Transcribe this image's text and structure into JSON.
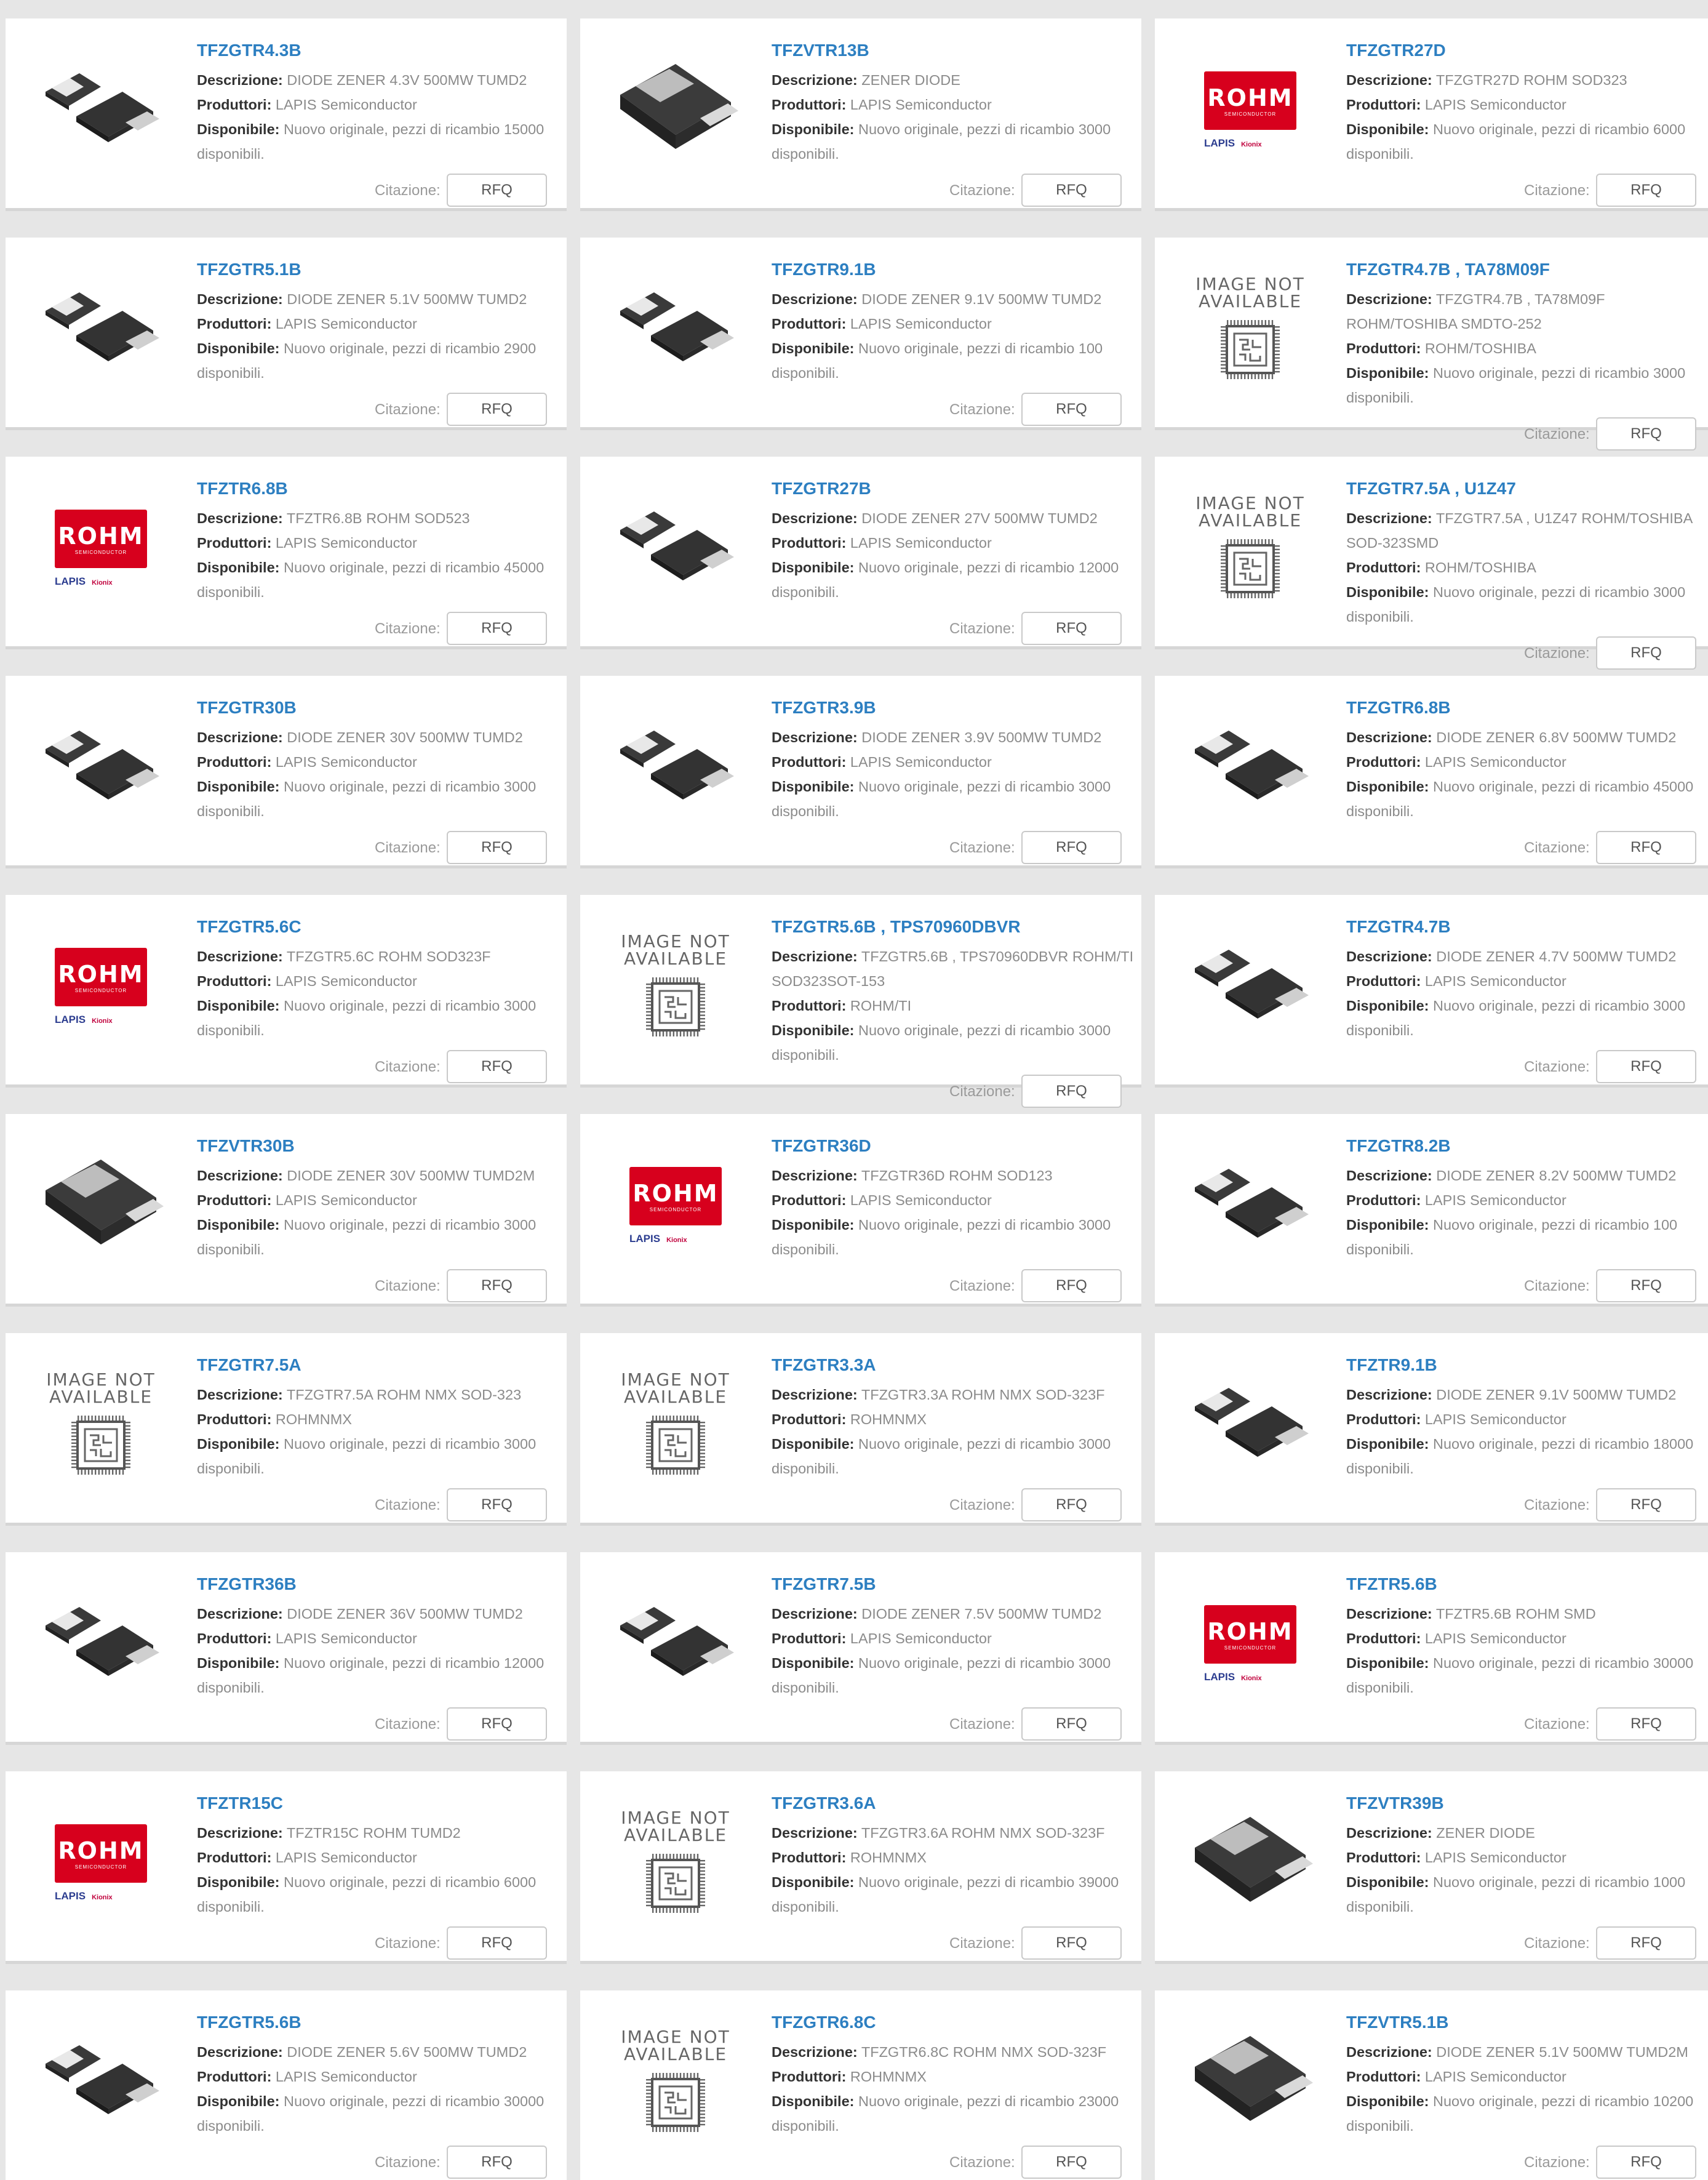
{
  "labels": {
    "descrizione": "Descrizione:",
    "produttori": "Produttori:",
    "disponibile": "Disponibile:",
    "citazione": "Citazione:",
    "rfq": "RFQ",
    "image_not_line1": "IMAGE NOT",
    "image_not_line2": "AVAILABLE",
    "rohm_logo": "ROHM",
    "rohm_sub": "SEMICONDUCTOR",
    "lapis_logo": "LAPIS",
    "kionix_logo": "Kionix"
  },
  "products": [
    {
      "title": "TFZGTR4.3B",
      "descrizione": "DIODE ZENER 4.3V 500MW TUMD2",
      "produttori": "LAPIS Semiconductor",
      "disponibile": "Nuovo originale, pezzi di ricambio 15000 disponibili.",
      "image": "diode-small"
    },
    {
      "title": "TFZVTR13B",
      "descrizione": "ZENER DIODE",
      "produttori": "LAPIS Semiconductor",
      "disponibile": "Nuovo originale, pezzi di ricambio 3000 disponibili.",
      "image": "diode-large"
    },
    {
      "title": "TFZGTR27D",
      "descrizione": "TFZGTR27D ROHM SOD323",
      "produttori": "LAPIS Semiconductor",
      "disponibile": "Nuovo originale, pezzi di ricambio 6000 disponibili.",
      "image": "rohm-logo"
    },
    {
      "title": "TFZGTR5.1B",
      "descrizione": "DIODE ZENER 5.1V 500MW TUMD2",
      "produttori": "LAPIS Semiconductor",
      "disponibile": "Nuovo originale, pezzi di ricambio 2900 disponibili.",
      "image": "diode-small"
    },
    {
      "title": "TFZGTR9.1B",
      "descrizione": "DIODE ZENER 9.1V 500MW TUMD2",
      "produttori": "LAPIS Semiconductor",
      "disponibile": "Nuovo originale, pezzi di ricambio 100 disponibili.",
      "image": "diode-small"
    },
    {
      "title": "TFZGTR4.7B , TA78M09F",
      "descrizione": "TFZGTR4.7B , TA78M09F ROHM/TOSHIBA SMDTO-252",
      "produttori": "ROHM/TOSHIBA",
      "disponibile": "Nuovo originale, pezzi di ricambio 3000 disponibili.",
      "image": "not-available"
    },
    {
      "title": "TFZTR6.8B",
      "descrizione": "TFZTR6.8B ROHM SOD523",
      "produttori": "LAPIS Semiconductor",
      "disponibile": "Nuovo originale, pezzi di ricambio 45000 disponibili.",
      "image": "rohm-logo"
    },
    {
      "title": "TFZGTR27B",
      "descrizione": "DIODE ZENER 27V 500MW TUMD2",
      "produttori": "LAPIS Semiconductor",
      "disponibile": "Nuovo originale, pezzi di ricambio 12000 disponibili.",
      "image": "diode-small"
    },
    {
      "title": "TFZGTR7.5A , U1Z47",
      "descrizione": "TFZGTR7.5A , U1Z47 ROHM/TOSHIBA SOD-323SMD",
      "produttori": "ROHM/TOSHIBA",
      "disponibile": "Nuovo originale, pezzi di ricambio 3000 disponibili.",
      "image": "not-available"
    },
    {
      "title": "TFZGTR30B",
      "descrizione": "DIODE ZENER 30V 500MW TUMD2",
      "produttori": "LAPIS Semiconductor",
      "disponibile": "Nuovo originale, pezzi di ricambio 3000 disponibili.",
      "image": "diode-small"
    },
    {
      "title": "TFZGTR3.9B",
      "descrizione": "DIODE ZENER 3.9V 500MW TUMD2",
      "produttori": "LAPIS Semiconductor",
      "disponibile": "Nuovo originale, pezzi di ricambio 3000 disponibili.",
      "image": "diode-small"
    },
    {
      "title": "TFZGTR6.8B",
      "descrizione": "DIODE ZENER 6.8V 500MW TUMD2",
      "produttori": "LAPIS Semiconductor",
      "disponibile": "Nuovo originale, pezzi di ricambio 45000 disponibili.",
      "image": "diode-small"
    },
    {
      "title": "TFZGTR5.6C",
      "descrizione": "TFZGTR5.6C ROHM SOD323F",
      "produttori": "LAPIS Semiconductor",
      "disponibile": "Nuovo originale, pezzi di ricambio 3000 disponibili.",
      "image": "rohm-logo"
    },
    {
      "title": "TFZGTR5.6B , TPS70960DBVR",
      "descrizione": "TFZGTR5.6B , TPS70960DBVR ROHM/TI SOD323SOT-153",
      "produttori": "ROHM/TI",
      "disponibile": "Nuovo originale, pezzi di ricambio 3000 disponibili.",
      "image": "not-available"
    },
    {
      "title": "TFZGTR4.7B",
      "descrizione": "DIODE ZENER 4.7V 500MW TUMD2",
      "produttori": "LAPIS Semiconductor",
      "disponibile": "Nuovo originale, pezzi di ricambio 3000 disponibili.",
      "image": "diode-small"
    },
    {
      "title": "TFZVTR30B",
      "descrizione": "DIODE ZENER 30V 500MW TUMD2M",
      "produttori": "LAPIS Semiconductor",
      "disponibile": "Nuovo originale, pezzi di ricambio 3000 disponibili.",
      "image": "diode-large"
    },
    {
      "title": "TFZGTR36D",
      "descrizione": "TFZGTR36D ROHM SOD123",
      "produttori": "LAPIS Semiconductor",
      "disponibile": "Nuovo originale, pezzi di ricambio 3000 disponibili.",
      "image": "rohm-logo"
    },
    {
      "title": "TFZGTR8.2B",
      "descrizione": "DIODE ZENER 8.2V 500MW TUMD2",
      "produttori": "LAPIS Semiconductor",
      "disponibile": "Nuovo originale, pezzi di ricambio 100 disponibili.",
      "image": "diode-small"
    },
    {
      "title": "TFZGTR7.5A",
      "descrizione": "TFZGTR7.5A ROHM NMX SOD-323",
      "produttori": "ROHMNMX",
      "disponibile": "Nuovo originale, pezzi di ricambio 3000 disponibili.",
      "image": "not-available"
    },
    {
      "title": "TFZGTR3.3A",
      "descrizione": "TFZGTR3.3A ROHM NMX SOD-323F",
      "produttori": "ROHMNMX",
      "disponibile": "Nuovo originale, pezzi di ricambio 3000 disponibili.",
      "image": "not-available"
    },
    {
      "title": "TFZTR9.1B",
      "descrizione": "DIODE ZENER 9.1V 500MW TUMD2",
      "produttori": "LAPIS Semiconductor",
      "disponibile": "Nuovo originale, pezzi di ricambio 18000 disponibili.",
      "image": "diode-small"
    },
    {
      "title": "TFZGTR36B",
      "descrizione": "DIODE ZENER 36V 500MW TUMD2",
      "produttori": "LAPIS Semiconductor",
      "disponibile": "Nuovo originale, pezzi di ricambio 12000 disponibili.",
      "image": "diode-small"
    },
    {
      "title": "TFZGTR7.5B",
      "descrizione": "DIODE ZENER 7.5V 500MW TUMD2",
      "produttori": "LAPIS Semiconductor",
      "disponibile": "Nuovo originale, pezzi di ricambio 3000 disponibili.",
      "image": "diode-small"
    },
    {
      "title": "TFZTR5.6B",
      "descrizione": "TFZTR5.6B ROHM SMD",
      "produttori": "LAPIS Semiconductor",
      "disponibile": "Nuovo originale, pezzi di ricambio 30000 disponibili.",
      "image": "rohm-logo"
    },
    {
      "title": "TFZTR15C",
      "descrizione": "TFZTR15C ROHM TUMD2",
      "produttori": "LAPIS Semiconductor",
      "disponibile": "Nuovo originale, pezzi di ricambio 6000 disponibili.",
      "image": "rohm-logo"
    },
    {
      "title": "TFZGTR3.6A",
      "descrizione": "TFZGTR3.6A ROHM NMX SOD-323F",
      "produttori": "ROHMNMX",
      "disponibile": "Nuovo originale, pezzi di ricambio 39000 disponibili.",
      "image": "not-available"
    },
    {
      "title": "TFZVTR39B",
      "descrizione": "ZENER DIODE",
      "produttori": "LAPIS Semiconductor",
      "disponibile": "Nuovo originale, pezzi di ricambio 1000 disponibili.",
      "image": "diode-large"
    },
    {
      "title": "TFZGTR5.6B",
      "descrizione": "DIODE ZENER 5.6V 500MW TUMD2",
      "produttori": "LAPIS Semiconductor",
      "disponibile": "Nuovo originale, pezzi di ricambio 30000 disponibili.",
      "image": "diode-small"
    },
    {
      "title": "TFZGTR6.8C",
      "descrizione": "TFZGTR6.8C ROHM NMX SOD-323F",
      "produttori": "ROHMNMX",
      "disponibile": "Nuovo originale, pezzi di ricambio 23000 disponibili.",
      "image": "not-available"
    },
    {
      "title": "TFZVTR5.1B",
      "descrizione": "DIODE ZENER 5.1V 500MW TUMD2M",
      "produttori": "LAPIS Semiconductor",
      "disponibile": "Nuovo originale, pezzi di ricambio 10200 disponibili.",
      "image": "diode-large"
    }
  ]
}
